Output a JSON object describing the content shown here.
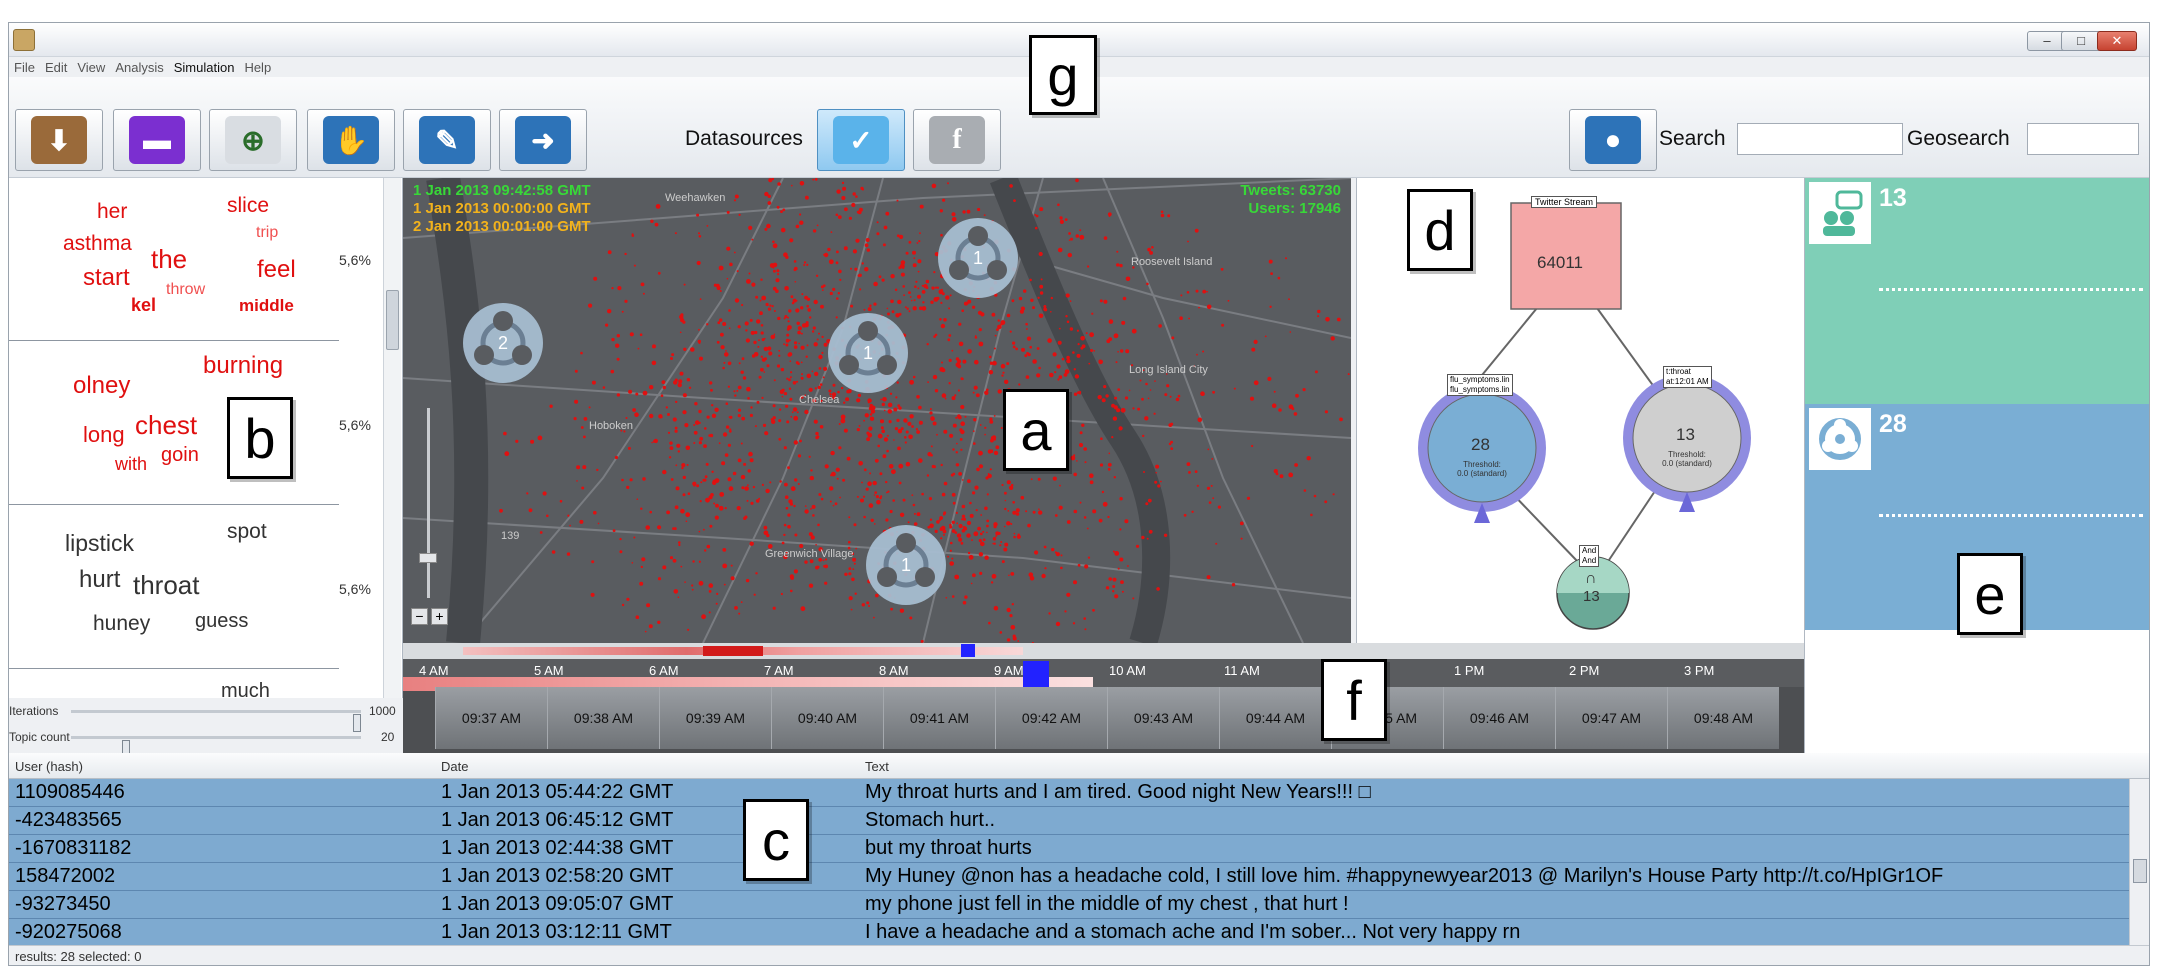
{
  "menu": [
    "File",
    "Edit",
    "View",
    "Analysis",
    "Simulation",
    "Help"
  ],
  "toolbar": {
    "datasources_label": "Datasources",
    "search_label": "Search",
    "geosearch_label": "Geosearch",
    "search_value": "",
    "geosearch_value": ""
  },
  "callouts": {
    "g": "g",
    "a": "a",
    "b": "b",
    "c": "c",
    "d": "d",
    "e": "e",
    "f": "f"
  },
  "topics": [
    {
      "words": [
        "her",
        "slice",
        "trip",
        "asthma",
        "the",
        "feel",
        "start",
        "throw",
        "kel",
        "middle"
      ],
      "percent": "5,6%"
    },
    {
      "words": [
        "burning",
        "olney",
        "chest",
        "long",
        "goin",
        "with"
      ],
      "percent": "5,6%"
    },
    {
      "words": [
        "lipstick",
        "spot",
        "hurt",
        "throat",
        "huney",
        "guess"
      ],
      "percent": "5,6%"
    },
    {
      "words": [
        "much"
      ],
      "percent": ""
    }
  ],
  "sliders": {
    "iterations_label": "Iterations",
    "iterations_value": "1000",
    "iterations_level": 1.0,
    "topic_count_label": "Topic count",
    "topic_count_value": "20",
    "topic_count_level": 0.18
  },
  "map": {
    "time_current": "1 Jan 2013 09:42:58 GMT",
    "time_start": "1 Jan 2013 00:00:00 GMT",
    "time_end": "2 Jan 2013 00:01:00 GMT",
    "tweets": "Tweets: 63730",
    "users": "Users: 17946",
    "markers": [
      "1",
      "2",
      "1",
      "1"
    ],
    "zoom_out": "−",
    "zoom_in": "+",
    "places": [
      "Weehawken",
      "Roosevelt Island",
      "Hoboken",
      "Chelsea",
      "Long Island City",
      "Greenwich Village",
      "139"
    ]
  },
  "graph": {
    "root_label": "Twitter Stream",
    "root_value": "64011",
    "left_tag_1": "flu_symptoms.lin",
    "left_tag_2": "flu_symptoms.lin",
    "left_value": "28",
    "left_threshold": "Threshold:",
    "left_threshold_val": "0.0 (standard)",
    "right_tag_1": "t:throat",
    "right_tag_2": "at:12:01 AM",
    "right_value": "13",
    "right_threshold": "Threshold:",
    "right_threshold_val": "0.0 (standard)",
    "and_tag_1": "And",
    "and_tag_2": "And",
    "and_symbol": "∩",
    "and_value": "13"
  },
  "panel_e": {
    "top_count": "13",
    "bottom_count": "28",
    "top_color": "#7fcfb7",
    "bottom_color": "#7aaed4"
  },
  "timeline": {
    "hours": [
      "4 AM",
      "5 AM",
      "6 AM",
      "7 AM",
      "8 AM",
      "9 AM",
      "10 AM",
      "11 AM",
      "12 PM",
      "1 PM",
      "2 PM",
      "3 PM"
    ],
    "minutes": [
      "09:37 AM",
      "09:38 AM",
      "09:39 AM",
      "09:40 AM",
      "09:41 AM",
      "09:42 AM",
      "09:43 AM",
      "09:44 AM",
      "09:45 AM",
      "09:46 AM",
      "09:47 AM",
      "09:48 AM"
    ]
  },
  "table": {
    "columns": [
      "User (hash)",
      "Date",
      "Text"
    ],
    "rows": [
      [
        "1109085446",
        "1 Jan 2013 05:44:22 GMT",
        "My throat hurts and I am tired. Good night New Years!!! □"
      ],
      [
        "-423483565",
        "1 Jan 2013 06:45:12 GMT",
        "Stomach hurt.."
      ],
      [
        "-1670831182",
        "1 Jan 2013 02:44:38 GMT",
        "but my throat hurts"
      ],
      [
        "158472002",
        "1 Jan 2013 02:58:20 GMT",
        "My Huney @non has a headache cold,  I still love him. #happynewyear2013  @ Marilyn's House Party http://t.co/HpIGr1OF"
      ],
      [
        "-93273450",
        "1 Jan 2013 09:05:07 GMT",
        "my phone just fell in the middle of my chest , that hurt !"
      ],
      [
        "-920275068",
        "1 Jan 2013 03:12:11 GMT",
        "I have a headache and a stomach ache and I'm sober... Not very happy rn"
      ]
    ],
    "status": "results: 28 selected: 0"
  },
  "colors": {
    "map_points": "#e01010",
    "marker": "#a7bdd0",
    "node_left": "#7aaed4",
    "node_right": "#cfcfcf",
    "node_root": "#f4a7a7",
    "node_and": "#6aa997",
    "selection": "#7eaad0"
  }
}
